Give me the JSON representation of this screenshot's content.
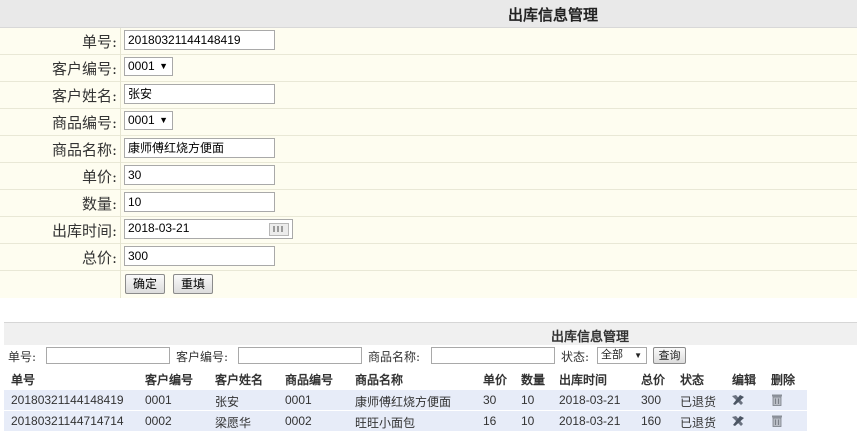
{
  "form": {
    "title": "出库信息管理",
    "labels": {
      "order_no": "单号:",
      "customer_no": "客户编号:",
      "customer_name": "客户姓名:",
      "product_no": "商品编号:",
      "product_name": "商品名称:",
      "unit_price": "单价:",
      "quantity": "数量:",
      "out_time": "出库时间:",
      "total": "总价:"
    },
    "values": {
      "order_no": "20180321144148419",
      "customer_no": "0001",
      "customer_name": "张安",
      "product_no": "0001",
      "product_name": "康师傅红烧方便面",
      "unit_price": "30",
      "quantity": "10",
      "out_time": "2018-03-21",
      "total": "300"
    },
    "buttons": {
      "confirm": "确定",
      "reset": "重填"
    }
  },
  "list": {
    "title": "出库信息管理",
    "search": {
      "order_no_label": "单号:",
      "customer_no_label": "客户编号:",
      "product_name_label": "商品名称:",
      "status_label": "状态:",
      "status_value": "全部",
      "query_button": "查询"
    },
    "columns": [
      "单号",
      "客户编号",
      "客户姓名",
      "商品编号",
      "商品名称",
      "单价",
      "数量",
      "出库时间",
      "总价",
      "状态",
      "编辑",
      "删除"
    ],
    "rows": [
      {
        "order_no": "20180321144148419",
        "customer_no": "0001",
        "customer_name": "张安",
        "product_no": "0001",
        "product_name": "康师傅红烧方便面",
        "unit_price": "30",
        "quantity": "10",
        "out_time": "2018-03-21",
        "total": "300",
        "status": "已退货"
      },
      {
        "order_no": "20180321144714714",
        "customer_no": "0002",
        "customer_name": "梁愿华",
        "product_no": "0002",
        "product_name": "旺旺小面包",
        "unit_price": "16",
        "quantity": "10",
        "out_time": "2018-03-21",
        "total": "160",
        "status": "已退货"
      }
    ]
  },
  "colors": {
    "form_bg": "#fefdf0",
    "header_bg": "#e9e9e9",
    "row_bg": "#e7ecf8"
  },
  "icons": {
    "edit": "edit-tools-icon",
    "delete": "trash-icon",
    "calendar": "calendar-icon"
  }
}
